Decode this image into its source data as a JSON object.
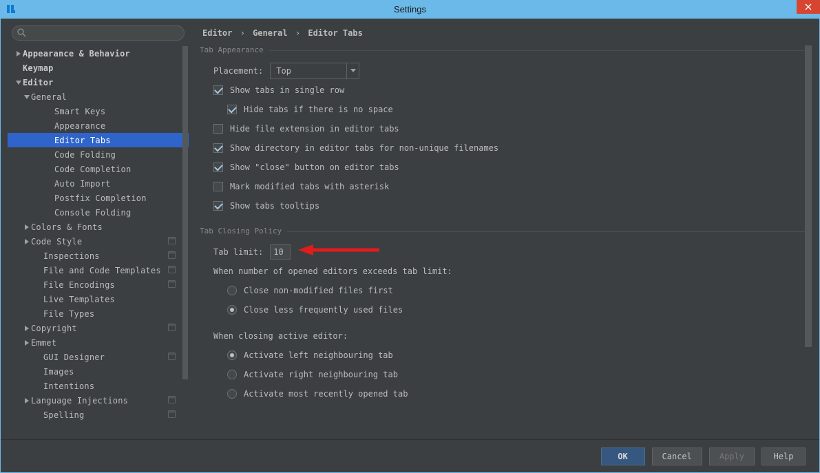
{
  "window": {
    "title": "Settings"
  },
  "search": {
    "placeholder": ""
  },
  "sidebar": {
    "items": [
      {
        "label": "Appearance & Behavior",
        "indent": 0,
        "arrow": "right",
        "bold": true,
        "scope": false
      },
      {
        "label": "Keymap",
        "indent": 0,
        "arrow": "none",
        "bold": true,
        "scope": false
      },
      {
        "label": "Editor",
        "indent": 0,
        "arrow": "down",
        "bold": true,
        "scope": false
      },
      {
        "label": "General",
        "indent": 1,
        "arrow": "down",
        "bold": false,
        "scope": false
      },
      {
        "label": "Smart Keys",
        "indent": 3,
        "arrow": "none",
        "bold": false,
        "scope": false
      },
      {
        "label": "Appearance",
        "indent": 3,
        "arrow": "none",
        "bold": false,
        "scope": false
      },
      {
        "label": "Editor Tabs",
        "indent": 3,
        "arrow": "none",
        "bold": false,
        "scope": false,
        "selected": true
      },
      {
        "label": "Code Folding",
        "indent": 3,
        "arrow": "none",
        "bold": false,
        "scope": false
      },
      {
        "label": "Code Completion",
        "indent": 3,
        "arrow": "none",
        "bold": false,
        "scope": false
      },
      {
        "label": "Auto Import",
        "indent": 3,
        "arrow": "none",
        "bold": false,
        "scope": false
      },
      {
        "label": "Postfix Completion",
        "indent": 3,
        "arrow": "none",
        "bold": false,
        "scope": false
      },
      {
        "label": "Console Folding",
        "indent": 3,
        "arrow": "none",
        "bold": false,
        "scope": false
      },
      {
        "label": "Colors & Fonts",
        "indent": 1,
        "arrow": "right",
        "bold": false,
        "scope": false
      },
      {
        "label": "Code Style",
        "indent": 1,
        "arrow": "right",
        "bold": false,
        "scope": true
      },
      {
        "label": "Inspections",
        "indent": 2,
        "arrow": "none",
        "bold": false,
        "scope": true
      },
      {
        "label": "File and Code Templates",
        "indent": 2,
        "arrow": "none",
        "bold": false,
        "scope": true
      },
      {
        "label": "File Encodings",
        "indent": 2,
        "arrow": "none",
        "bold": false,
        "scope": true
      },
      {
        "label": "Live Templates",
        "indent": 2,
        "arrow": "none",
        "bold": false,
        "scope": false
      },
      {
        "label": "File Types",
        "indent": 2,
        "arrow": "none",
        "bold": false,
        "scope": false
      },
      {
        "label": "Copyright",
        "indent": 1,
        "arrow": "right",
        "bold": false,
        "scope": true
      },
      {
        "label": "Emmet",
        "indent": 1,
        "arrow": "right",
        "bold": false,
        "scope": false
      },
      {
        "label": "GUI Designer",
        "indent": 2,
        "arrow": "none",
        "bold": false,
        "scope": true
      },
      {
        "label": "Images",
        "indent": 2,
        "arrow": "none",
        "bold": false,
        "scope": false
      },
      {
        "label": "Intentions",
        "indent": 2,
        "arrow": "none",
        "bold": false,
        "scope": false
      },
      {
        "label": "Language Injections",
        "indent": 1,
        "arrow": "right",
        "bold": false,
        "scope": true
      },
      {
        "label": "Spelling",
        "indent": 2,
        "arrow": "none",
        "bold": false,
        "scope": true
      }
    ]
  },
  "breadcrumb": {
    "p0": "Editor",
    "p1": "General",
    "p2": "Editor Tabs",
    "sep": "›"
  },
  "groups": {
    "appearance": {
      "title": "Tab Appearance",
      "placement_label": "Placement:",
      "placement_value": "Top",
      "cb_single_row": "Show tabs in single row",
      "cb_hide_no_space": "Hide tabs if there is no space",
      "cb_hide_ext": "Hide file extension in editor tabs",
      "cb_show_dir": "Show directory in editor tabs for non-unique filenames",
      "cb_show_close": "Show \"close\" button on editor tabs",
      "cb_mark_modified": "Mark modified tabs with asterisk",
      "cb_tooltips": "Show tabs tooltips"
    },
    "closing": {
      "title": "Tab Closing Policy",
      "tab_limit_label": "Tab limit:",
      "tab_limit_value": "10",
      "exceed_label": "When number of opened editors exceeds tab limit:",
      "r_close_nonmod": "Close non-modified files first",
      "r_close_lfu": "Close less frequently used files",
      "closing_active_label": "When closing active editor:",
      "r_act_left": "Activate left neighbouring tab",
      "r_act_right": "Activate right neighbouring tab",
      "r_act_recent": "Activate most recently opened tab"
    }
  },
  "buttons": {
    "ok": "OK",
    "cancel": "Cancel",
    "apply": "Apply",
    "help": "Help"
  }
}
